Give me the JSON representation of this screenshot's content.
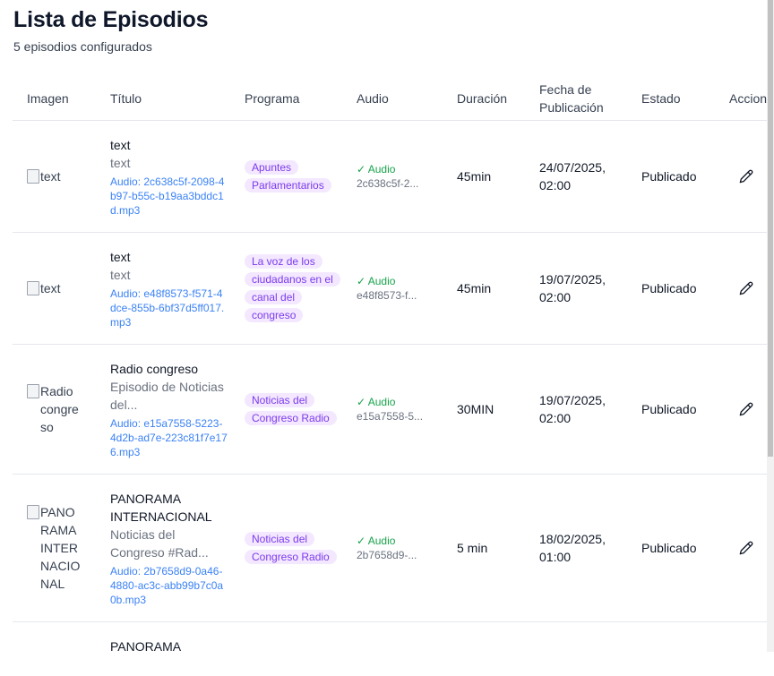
{
  "header": {
    "title": "Lista de Episodios",
    "subtitle": "5 episodios configurados"
  },
  "table": {
    "columns": {
      "image": "Imagen",
      "title": "Título",
      "program": "Programa",
      "audio": "Audio",
      "duration": "Duración",
      "date": "Fecha de Publicación",
      "state": "Estado",
      "actions": "Acciones"
    },
    "rows": [
      {
        "image_alt": "text",
        "title": "text",
        "description": "text",
        "file": "Audio: 2c638c5f-2098-4b97-b55c-b19aa3bddc1d.mp3",
        "program": "Apuntes Parlamentarios",
        "audio_status": "✓ Audio",
        "audio_id": "2c638c5f-2...",
        "duration": "45min",
        "date": "24/07/2025, 02:00",
        "state": "Publicado"
      },
      {
        "image_alt": "text",
        "title": "text",
        "description": "text",
        "file": "Audio: e48f8573-f571-4dce-855b-6bf37d5ff017.mp3",
        "program": "La voz de los ciudadanos en el canal del congreso",
        "audio_status": "✓ Audio",
        "audio_id": "e48f8573-f...",
        "duration": "45min",
        "date": "19/07/2025, 02:00",
        "state": "Publicado"
      },
      {
        "image_alt": "Radio congreso",
        "title": "Radio congreso",
        "description": "Episodio de Noticias del...",
        "file": "Audio: e15a7558-5223-4d2b-ad7e-223c81f7e176.mp3",
        "program": "Noticias del Congreso Radio",
        "audio_status": "✓ Audio",
        "audio_id": "e15a7558-5...",
        "duration": "30MIN",
        "date": "19/07/2025, 02:00",
        "state": "Publicado"
      },
      {
        "image_alt": "PANORAMA INTERNACIONAL",
        "title": "PANORAMA INTERNACIONAL",
        "description": "Noticias del Congreso #Rad...",
        "file": "Audio: 2b7658d9-0a46-4880-ac3c-abb99b7c0a0b.mp3",
        "program": "Noticias del Congreso Radio",
        "audio_status": "✓ Audio",
        "audio_id": "2b7658d9-...",
        "duration": "5 min",
        "date": "18/02/2025, 01:00",
        "state": "Publicado"
      },
      {
        "title": "PANORAMA"
      }
    ]
  },
  "icons": {
    "edit": "pencil-icon",
    "broken_image": "broken-image-icon"
  },
  "colors": {
    "link": "#3b82f6",
    "audio_ok": "#16a34a",
    "program_badge_bg": "#f3e8ff",
    "program_badge_text": "#7c3aed"
  }
}
